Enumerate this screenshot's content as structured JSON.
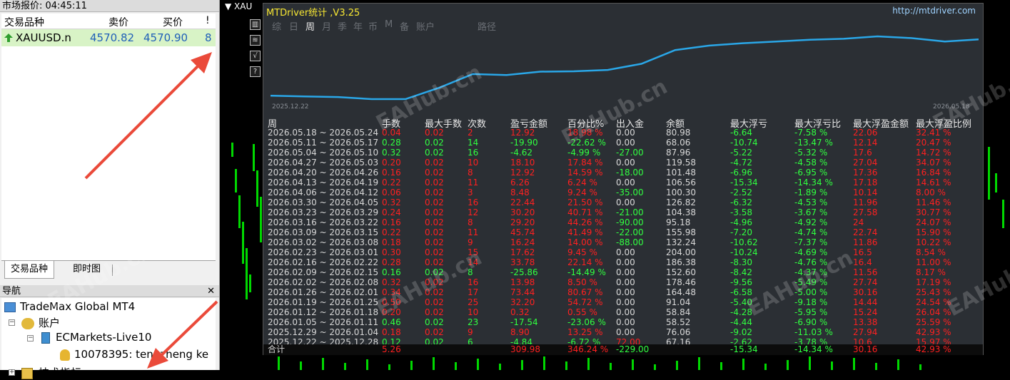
{
  "market_watch": {
    "title": "市场报价: 04:45:11",
    "headers": [
      "交易品种",
      "卖价",
      "买价",
      "!"
    ],
    "row": {
      "symbol": "XAUUSD.n",
      "bid": "4570.82",
      "ask": "4570.90",
      "spread": "8"
    },
    "tabs": [
      "交易品种",
      "即时图"
    ]
  },
  "navigator": {
    "title": "导航",
    "items": [
      {
        "label": "TradeMax Global MT4"
      },
      {
        "label": "账户"
      },
      {
        "label": "ECMarkets-Live10"
      },
      {
        "label": "10078395: tengzheng ke"
      },
      {
        "label": "技术指标"
      }
    ]
  },
  "chart": {
    "symbol_label": "XAU",
    "sidebar_icons": [
      "chart-icon",
      "indicator-icon",
      "check-icon",
      "help-icon"
    ]
  },
  "dashboard": {
    "title": "MTDriver统计 ,V3.25",
    "url": "http://mtdriver.com",
    "tabs": [
      "综",
      "日",
      "周",
      "月",
      "季",
      "年",
      "币",
      "M",
      "备",
      "账户",
      "路径"
    ],
    "active_tab": "周",
    "curve_start": "2025.12.22",
    "curve_end": "2026.05.18",
    "curve_values": [
      0.22,
      0.2,
      0.18,
      0.12,
      0.12,
      0.45,
      0.85,
      0.82,
      0.92,
      0.93,
      0.97,
      1.15,
      1.55,
      1.68,
      1.75,
      1.8,
      1.85,
      1.88,
      1.95,
      1.9,
      1.8,
      1.86
    ],
    "columns": [
      "周",
      "手数",
      "最大手数",
      "次数",
      "盈亏金额",
      "百分比%",
      "出入金",
      "余额",
      "最大浮亏",
      "最大浮亏比",
      "最大浮盈金额",
      "最大浮盈比例"
    ],
    "rows": [
      [
        "2026.05.18 ~ 2026.05.24",
        "0.04",
        "0.02",
        "2",
        "12.92",
        "18.98 %",
        "0.00",
        "80.98",
        "-6.64",
        "-7.58 %",
        "22.06",
        "32.41 %"
      ],
      [
        "2026.05.11 ~ 2026.05.17",
        "0.28",
        "0.02",
        "14",
        "-19.90",
        "-22.62 %",
        "0.00",
        "68.06",
        "-10.74",
        "-13.47 %",
        "12.14",
        "20.47 %"
      ],
      [
        "2026.05.04 ~ 2026.05.10",
        "0.32",
        "0.02",
        "16",
        "-4.62",
        "-4.99 %",
        "-27.00",
        "87.96",
        "-5.22",
        "-5.32 %",
        "17.6",
        "14.72 %"
      ],
      [
        "2026.04.27 ~ 2026.05.03",
        "0.20",
        "0.02",
        "10",
        "18.10",
        "17.84 %",
        "0.00",
        "119.58",
        "-4.72",
        "-4.58 %",
        "27.04",
        "34.07 %"
      ],
      [
        "2026.04.20 ~ 2026.04.26",
        "0.16",
        "0.02",
        "8",
        "12.92",
        "14.59 %",
        "-18.00",
        "101.48",
        "-6.96",
        "-6.95 %",
        "17.36",
        "16.84 %"
      ],
      [
        "2026.04.13 ~ 2026.04.19",
        "0.22",
        "0.02",
        "11",
        "6.26",
        "6.24 %",
        "0.00",
        "106.56",
        "-15.34",
        "-14.34 %",
        "17.18",
        "14.61 %"
      ],
      [
        "2026.04.06 ~ 2026.04.12",
        "0.06",
        "0.02",
        "3",
        "8.48",
        "9.24 %",
        "-35.00",
        "100.30",
        "-2.52",
        "-1.89 %",
        "10.14",
        "8.00 %"
      ],
      [
        "2026.03.30 ~ 2026.04.05",
        "0.32",
        "0.02",
        "16",
        "22.44",
        "21.50 %",
        "0.00",
        "126.82",
        "-6.32",
        "-4.53 %",
        "11.96",
        "11.46 %"
      ],
      [
        "2026.03.23 ~ 2026.03.29",
        "0.24",
        "0.02",
        "12",
        "30.20",
        "40.71 %",
        "-21.00",
        "104.38",
        "-3.58",
        "-3.67 %",
        "27.58",
        "30.77 %"
      ],
      [
        "2026.03.16 ~ 2026.03.22",
        "0.16",
        "0.02",
        "8",
        "29.20",
        "44.26 %",
        "-90.00",
        "95.18",
        "-4.96",
        "-4.92 %",
        "24",
        "24.07 %"
      ],
      [
        "2026.03.09 ~ 2026.03.15",
        "0.22",
        "0.02",
        "11",
        "45.74",
        "41.49 %",
        "-22.00",
        "155.98",
        "-7.20",
        "-4.74 %",
        "22.74",
        "15.90 %"
      ],
      [
        "2026.03.02 ~ 2026.03.08",
        "0.18",
        "0.02",
        "9",
        "16.24",
        "14.00 %",
        "-88.00",
        "132.24",
        "-10.62",
        "-7.37 %",
        "11.86",
        "10.22 %"
      ],
      [
        "2026.02.23 ~ 2026.03.01",
        "0.30",
        "0.02",
        "15",
        "17.62",
        "9.45 %",
        "0.00",
        "204.00",
        "-10.24",
        "-4.69 %",
        "16.5",
        "8.54 %"
      ],
      [
        "2026.02.16 ~ 2026.02.22",
        "0.28",
        "0.02",
        "14",
        "33.78",
        "22.14 %",
        "0.00",
        "186.38",
        "-8.30",
        "-4.76 %",
        "16.4",
        "11.00 %"
      ],
      [
        "2026.02.09 ~ 2026.02.15",
        "0.16",
        "0.02",
        "8",
        "-25.86",
        "-14.49 %",
        "0.00",
        "152.60",
        "-8.42",
        "-4.37 %",
        "11.56",
        "8.17 %"
      ],
      [
        "2026.02.02 ~ 2026.02.08",
        "0.32",
        "0.02",
        "16",
        "13.98",
        "8.50 %",
        "0.00",
        "178.46",
        "-9.56",
        "-5.49 %",
        "27.74",
        "17.19 %"
      ],
      [
        "2026.01.26 ~ 2026.02.01",
        "0.34",
        "0.02",
        "17",
        "73.44",
        "80.67 %",
        "0.00",
        "164.48",
        "-6.58",
        "-5.00 %",
        "30.16",
        "25.43 %"
      ],
      [
        "2026.01.19 ~ 2026.01.25",
        "0.50",
        "0.02",
        "25",
        "32.20",
        "54.72 %",
        "0.00",
        "91.04",
        "-5.40",
        "-9.18 %",
        "14.44",
        "24.54 %"
      ],
      [
        "2026.01.12 ~ 2026.01.18",
        "0.20",
        "0.02",
        "10",
        "0.32",
        "0.55 %",
        "0.00",
        "58.84",
        "-4.28",
        "-5.95 %",
        "15.24",
        "26.04 %"
      ],
      [
        "2026.01.05 ~ 2026.01.11",
        "0.46",
        "0.02",
        "23",
        "-17.54",
        "-23.06 %",
        "0.00",
        "58.52",
        "-4.44",
        "-6.90 %",
        "13.38",
        "25.59 %"
      ],
      [
        "2025.12.29 ~ 2026.01.04",
        "0.18",
        "0.02",
        "9",
        "8.90",
        "13.25 %",
        "0.00",
        "76.06",
        "-9.02",
        "-11.03 %",
        "27.94",
        "42.93 %"
      ],
      [
        "2025.12.22 ~ 2025.12.28",
        "0.12",
        "0.02",
        "6",
        "-4.84",
        "-6.72 %",
        "72.00",
        "67.16",
        "-2.62",
        "-3.78 %",
        "10.6",
        "15.97 %"
      ]
    ],
    "total": {
      "label": "合计",
      "lots": "5.26",
      "profit": "309.98",
      "percent": "346.24 %",
      "deposit": "-229.00",
      "max_dd": "-15.34",
      "max_dd_pct": "-14.34 %",
      "max_float_profit": "30.16",
      "max_float_pct": "42.93 %"
    }
  },
  "watermark": "EAHub.cn",
  "colors": {
    "positive": "#30ff40",
    "negative": "#ff2020",
    "title": "#f7e733",
    "curve": "#2aa7e8"
  }
}
